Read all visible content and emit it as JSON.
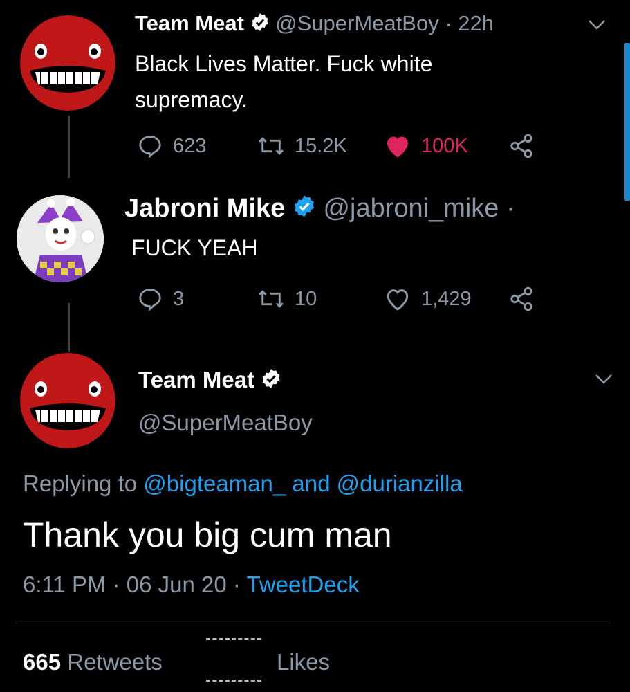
{
  "tweet1": {
    "display_name": "Team Meat",
    "handle": "@SuperMeatBoy",
    "time": "· 22h",
    "text": "Black Lives Matter. Fuck white supremacy.",
    "replies": "623",
    "retweets": "15.2K",
    "likes": "100K",
    "liked": true
  },
  "tweet2": {
    "display_name": "Jabroni Mike",
    "handle": "@jabroni_mike",
    "time_dot": "·",
    "text": "FUCK YEAH",
    "replies": "3",
    "retweets": "10",
    "likes": "1,429"
  },
  "tweet3": {
    "display_name": "Team Meat",
    "handle": "@SuperMeatBoy",
    "replying_prefix": "Replying to",
    "replying_user1": "@bigteaman_",
    "replying_and": "and",
    "replying_user2": "@durianzilla",
    "text": "Thank you big cum man",
    "timestamp": "6:11 PM · 06 Jun 20 · ",
    "source": "TweetDeck",
    "retweet_count": "665",
    "retweet_label": "Retweets",
    "likes_label": "Likes"
  },
  "colors": {
    "background": "#000000",
    "accent_blue": "#1da1f2",
    "like_red": "#e0245e",
    "muted": "#8b98a5"
  }
}
